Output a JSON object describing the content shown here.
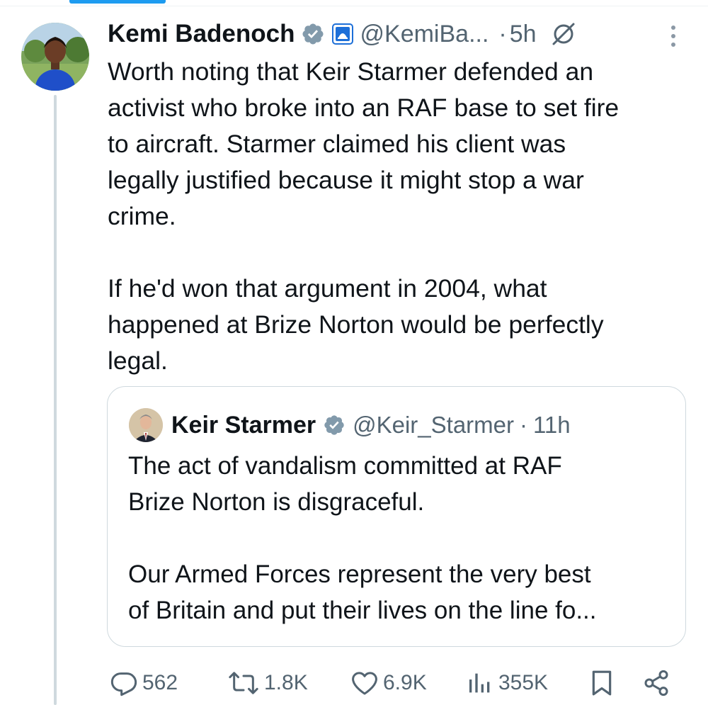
{
  "tweet": {
    "author_name": "Kemi Badenoch",
    "handle": "@KemiBa...",
    "dot": "·",
    "time": "5h",
    "body": "Worth noting that Keir Starmer defended an\nactivist who broke into an RAF base to set fire\nto aircraft. Starmer claimed his client was\nlegally justified because it might stop a war\ncrime.\n\nIf he'd won that argument in 2004, what\nhappened at Brize Norton would be perfectly\nlegal."
  },
  "quoted_tweet": {
    "author_name": "Keir Starmer",
    "handle": "@Keir_Starmer",
    "dot": "·",
    "time": "11h",
    "body": "The act of vandalism committed at RAF\nBrize Norton is disgraceful.\n\nOur Armed Forces represent the very best\nof Britain and put their lives on the line fo..."
  },
  "actions": {
    "replies": "562",
    "reposts": "1.8K",
    "likes": "6.9K",
    "views": "355K"
  },
  "icons": [
    "verified-badge-icon",
    "affiliate-badge-icon",
    "grok-icon",
    "more-icon",
    "reply-icon",
    "repost-icon",
    "like-icon",
    "views-icon",
    "bookmark-icon",
    "share-icon"
  ],
  "colors": {
    "text": "#0f1419",
    "secondary": "#536471",
    "border": "#cfd9de",
    "accent": "#1d9bf0",
    "affiliate": "#1d6fd8"
  }
}
